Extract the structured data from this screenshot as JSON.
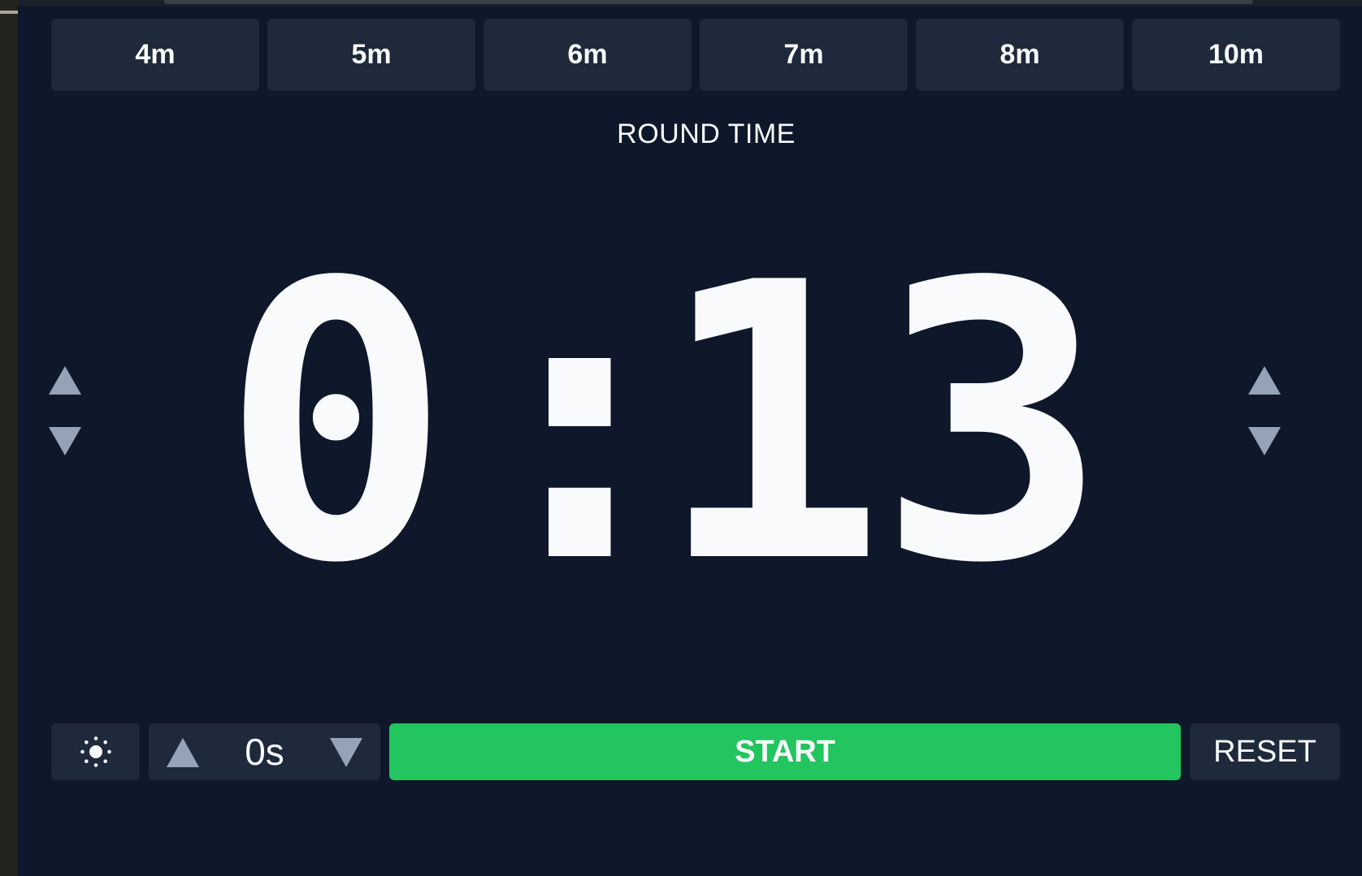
{
  "presets": [
    "4m",
    "5m",
    "6m",
    "7m",
    "8m",
    "10m"
  ],
  "round_label": "ROUND TIME",
  "timer": {
    "minutes": "0",
    "separator": ":",
    "seconds": "13"
  },
  "controls": {
    "theme_icon": "sun-icon",
    "stepper_value": "0s",
    "start_label": "START",
    "reset_label": "RESET"
  },
  "colors": {
    "background": "#0f172a",
    "panel": "#1e293b",
    "accent_green": "#22c55e",
    "arrow": "#94a3b8",
    "text": "#f8fafc"
  }
}
